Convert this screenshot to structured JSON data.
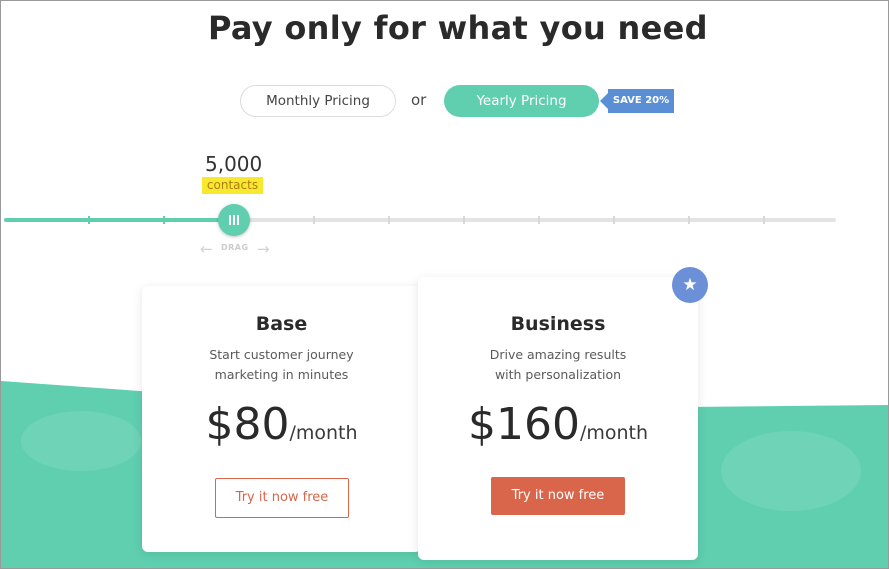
{
  "header": {
    "title": "Pay only for what you need"
  },
  "billing_toggle": {
    "monthly_label": "Monthly Pricing",
    "separator": "or",
    "yearly_label": "Yearly Pricing",
    "selected": "yearly",
    "save_badge": "SAVE 20%"
  },
  "slider": {
    "value": "5,000",
    "unit_label": "contacts",
    "drag_hint": "DRAG",
    "selected_step": 3,
    "total_steps": 11
  },
  "plans": [
    {
      "name": "Base",
      "desc_line1": "Start customer journey",
      "desc_line2": "marketing in minutes",
      "price": "$80",
      "period": "/month",
      "cta": "Try it now free"
    },
    {
      "name": "Business",
      "desc_line1": "Drive amazing results",
      "desc_line2": "with personalization",
      "price": "$160",
      "period": "/month",
      "cta": "Try it now free",
      "featured_icon": "star-icon"
    }
  ],
  "colors": {
    "accent_teal": "#5fcfb0",
    "cta_orange": "#d9654a",
    "badge_blue": "#5a8fd6",
    "highlight_yellow": "#f7ea2e"
  }
}
